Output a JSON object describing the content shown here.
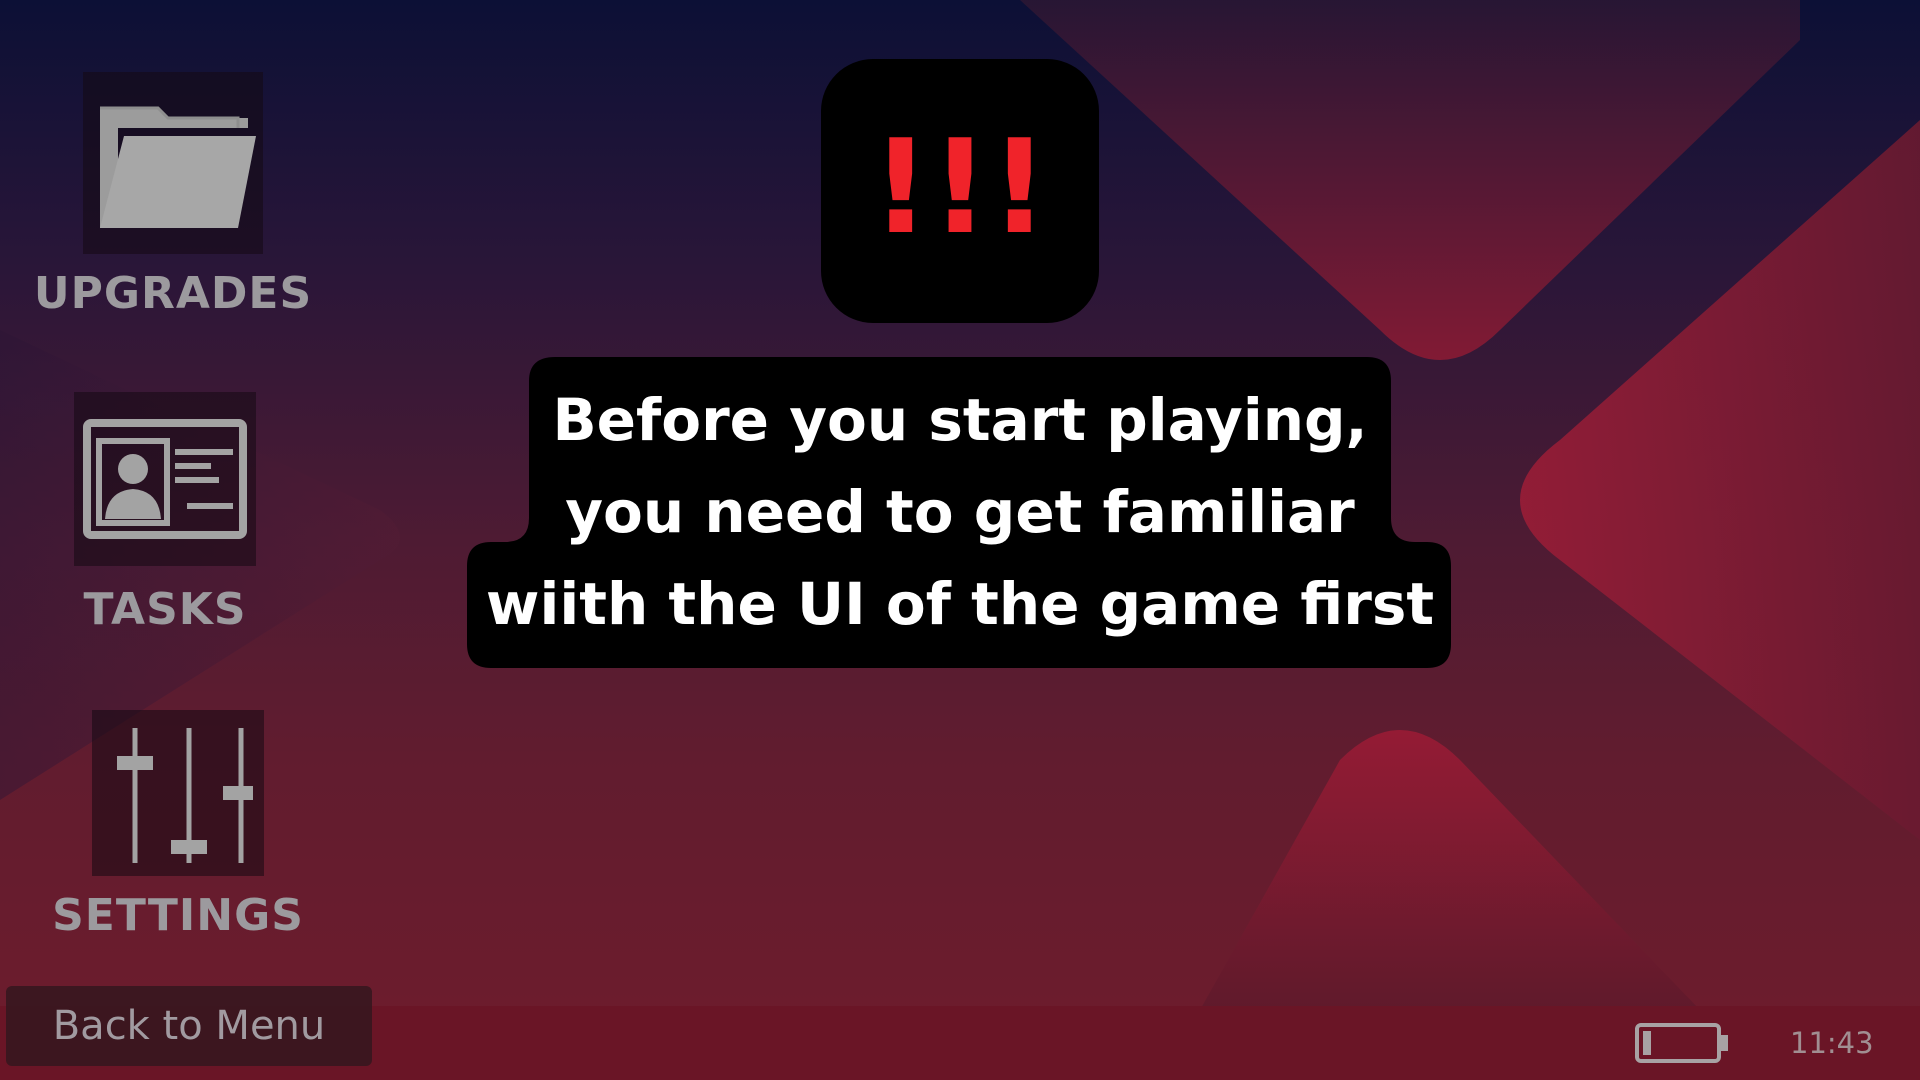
{
  "menu": {
    "items": [
      {
        "label": "UPGRADES",
        "icon": "folder-icon"
      },
      {
        "label": "TASKS",
        "icon": "id-card-icon"
      },
      {
        "label": "SETTINGS",
        "icon": "sliders-icon"
      }
    ]
  },
  "back_button": {
    "label": "Back to Menu"
  },
  "status": {
    "time": "11:43",
    "battery_icon": "battery-low-icon"
  },
  "tutorial": {
    "alert": "!!!",
    "message_lines": [
      "Before you start playing,",
      "you need to get familiar",
      "wiith the UI of the game first"
    ]
  },
  "colors": {
    "alert_red": "#f0232a",
    "label_gray": "#9c9a9e",
    "bottom_bar": "#6a1526",
    "accent_crimson": "#a8203d"
  }
}
